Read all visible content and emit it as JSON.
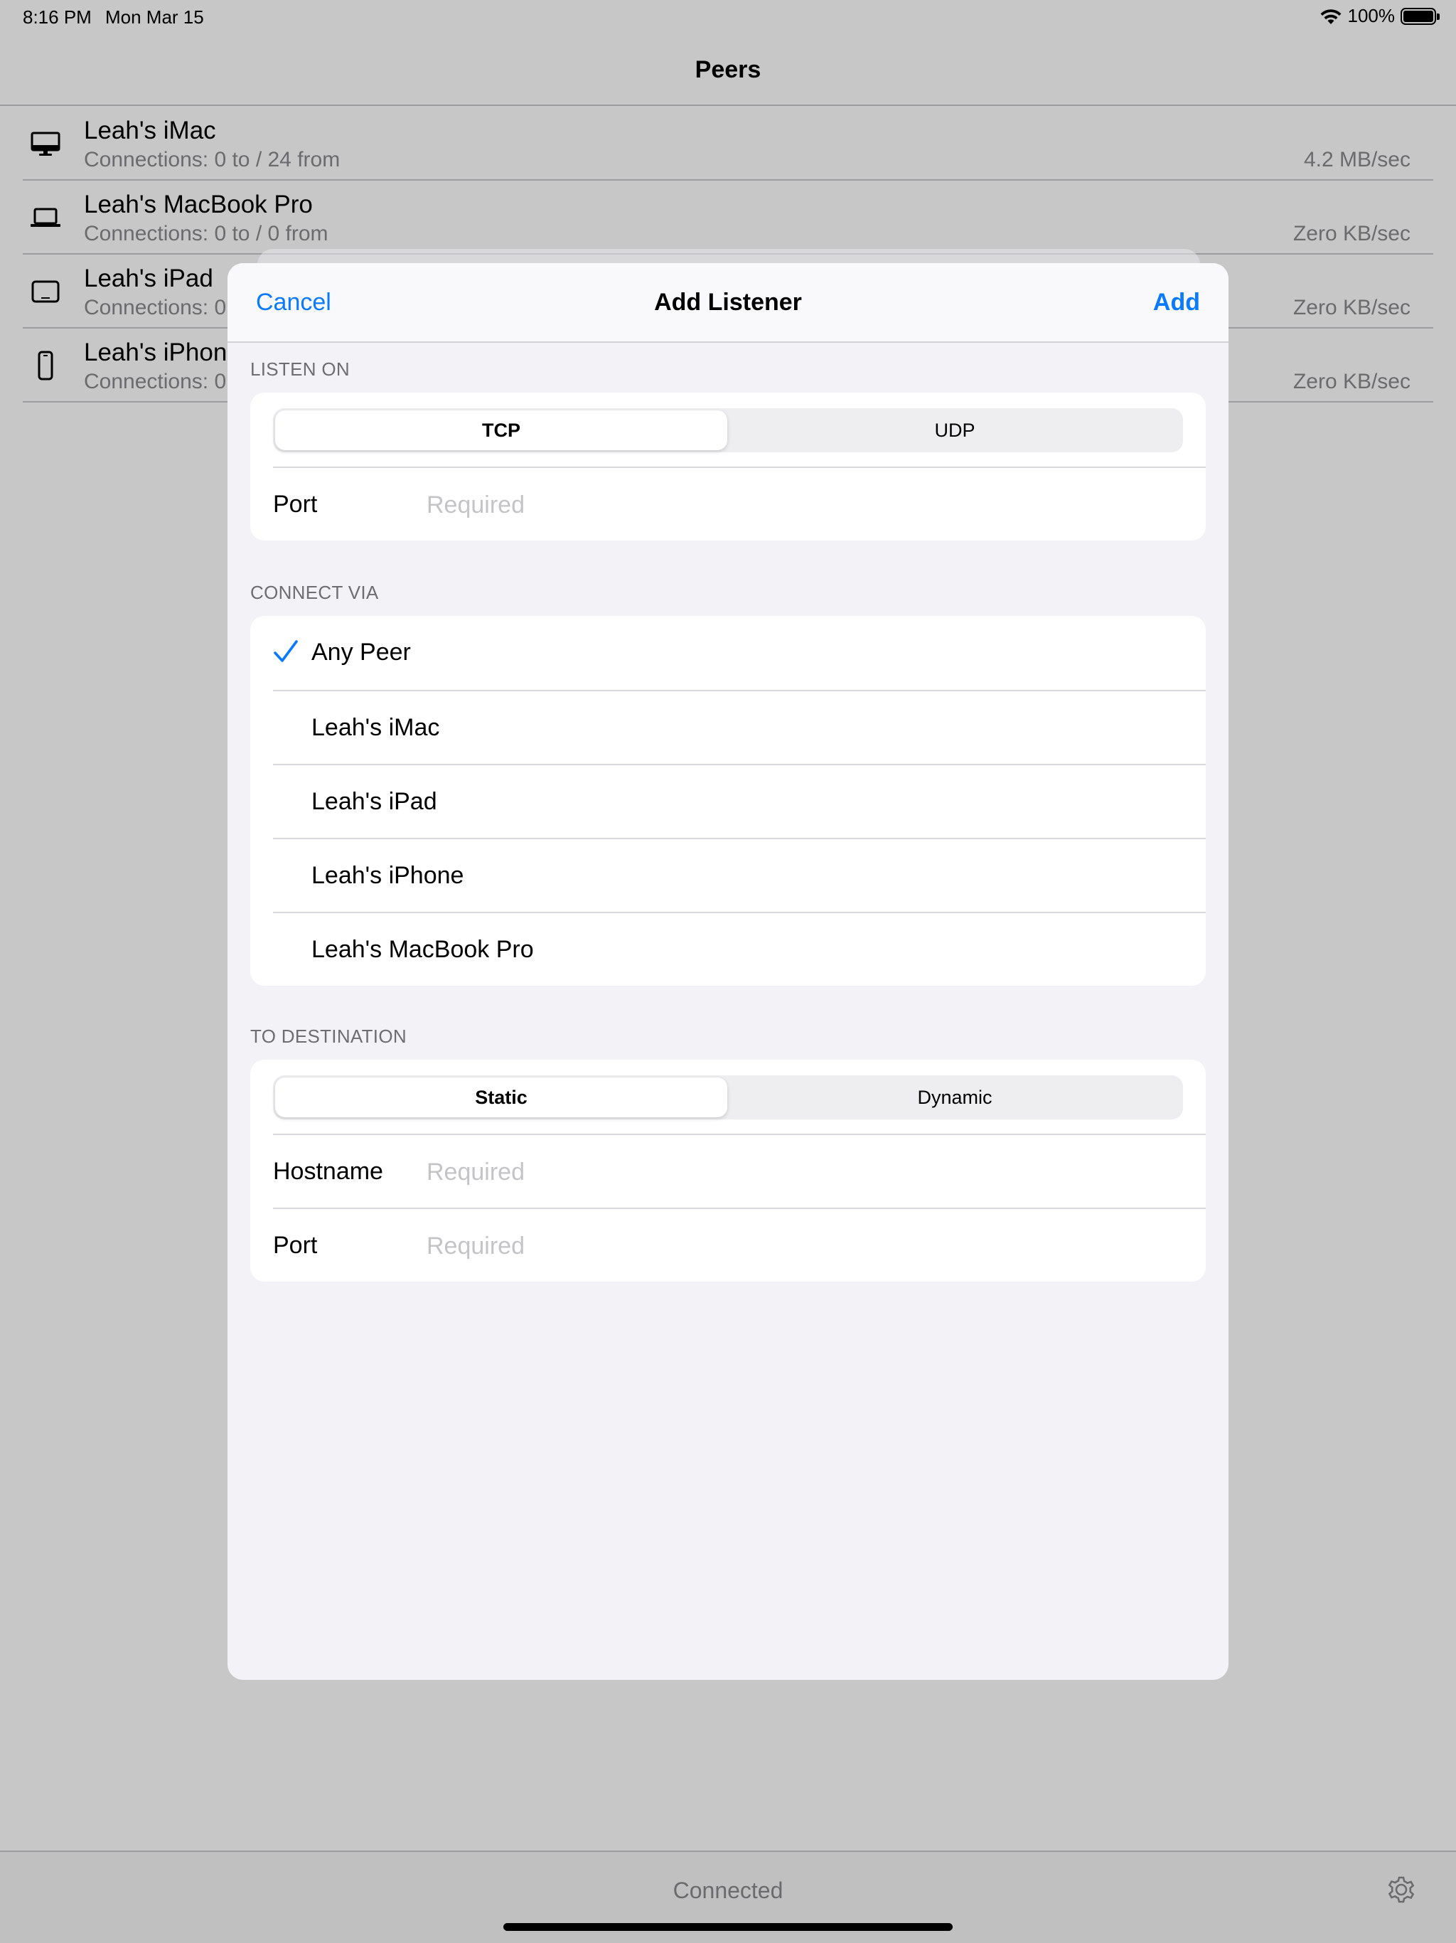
{
  "status_bar": {
    "time": "8:16 PM",
    "date": "Mon Mar 15",
    "battery": "100%"
  },
  "nav": {
    "title": "Peers"
  },
  "peers": [
    {
      "name": "Leah's iMac",
      "connections": "Connections: 0 to / 24 from",
      "rate": "4.2 MB/sec",
      "icon": "desktop-icon"
    },
    {
      "name": "Leah's MacBook Pro",
      "connections": "Connections: 0 to / 0 from",
      "rate": "Zero KB/sec",
      "icon": "laptop-icon"
    },
    {
      "name": "Leah's iPad",
      "connections": "Connections: 0",
      "rate": "Zero KB/sec",
      "icon": "tablet-icon"
    },
    {
      "name": "Leah's iPhone",
      "connections": "Connections: 0",
      "rate": "Zero KB/sec",
      "icon": "phone-icon"
    }
  ],
  "toolbar": {
    "status": "Connected",
    "settings_icon": "gear-icon"
  },
  "sheet": {
    "cancel_label": "Cancel",
    "title": "Add Listener",
    "add_label": "Add",
    "listen_on": {
      "label": "LISTEN ON",
      "protocols": [
        "TCP",
        "UDP"
      ],
      "selected_protocol": "TCP",
      "port_label": "Port",
      "port_value": "",
      "port_placeholder": "Required"
    },
    "connect_via": {
      "label": "CONNECT VIA",
      "options": [
        "Any Peer",
        "Leah's iMac",
        "Leah's iPad",
        "Leah's iPhone",
        "Leah's MacBook Pro"
      ],
      "selected": "Any Peer"
    },
    "to_destination": {
      "label": "TO DESTINATION",
      "modes": [
        "Static",
        "Dynamic"
      ],
      "selected_mode": "Static",
      "hostname_label": "Hostname",
      "hostname_value": "",
      "hostname_placeholder": "Required",
      "port_label": "Port",
      "port_value": "",
      "port_placeholder": "Required"
    }
  },
  "colors": {
    "accent": "#0a7aff",
    "secondary_text": "#8a8a8e",
    "placeholder": "#c4c4c7",
    "grouped_background": "#f2f2f7"
  }
}
